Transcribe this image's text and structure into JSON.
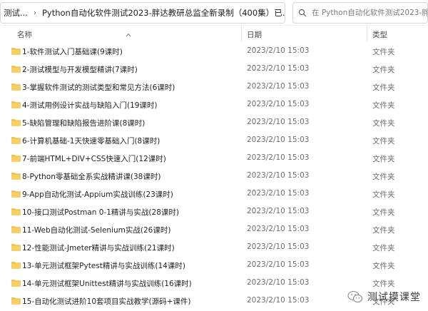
{
  "address_bar": {
    "crumbs": [
      "测试...",
      "Python自动化软件测试2023-胖达教研总监全新录制（400集）已..."
    ]
  },
  "search": {
    "placeholder": "在 Python自动化软件测试2023-胖达教研..."
  },
  "columns": {
    "name": "名称",
    "date": "日期",
    "type": "类型"
  },
  "rows": [
    {
      "name": "1-软件测试入门基础课(9课时)",
      "date": "2023/2/10 15:03",
      "type": "文件夹"
    },
    {
      "name": "2-测试模型与开发模型精讲(7课时)",
      "date": "2023/2/10 15:03",
      "type": "文件夹"
    },
    {
      "name": "3-掌握软件测试的测试类型和常见方法(6课时)",
      "date": "2023/2/10 15:03",
      "type": "文件夹"
    },
    {
      "name": "4-测试用例设计实战与缺陷入门(19课时)",
      "date": "2023/2/10 15:03",
      "type": "文件夹"
    },
    {
      "name": "5-缺陷管理和缺陷报告进阶课(8课时)",
      "date": "2023/2/10 15:03",
      "type": "文件夹"
    },
    {
      "name": "6-计算机基础-1天快速零基础入门(8课时)",
      "date": "2023/2/10 15:03",
      "type": "文件夹"
    },
    {
      "name": "7-前端HTML+DIV+CSS快速入门(12课时)",
      "date": "2023/2/10 15:03",
      "type": "文件夹"
    },
    {
      "name": "8-Python零基础全系实战精讲课(38课时)",
      "date": "2023/2/10 15:03",
      "type": "文件夹"
    },
    {
      "name": "9-App自动化测试-Appium实战训练(23课时)",
      "date": "2023/2/10 15:03",
      "type": "文件夹"
    },
    {
      "name": "10-接口测试Postman 0-1精讲与实战(28课时)",
      "date": "2023/2/10 15:03",
      "type": "文件夹"
    },
    {
      "name": "11-Web自动化测试-Selenium实战(26课时)",
      "date": "2023/2/10 15:03",
      "type": "文件夹"
    },
    {
      "name": "12-性能测试-Jmeter精讲与实战训练(21课时)",
      "date": "2023/2/10 15:03",
      "type": "文件夹"
    },
    {
      "name": "13-单元测试框架Pytest精讲与实战训练(14课时)",
      "date": "2023/2/10 15:03",
      "type": "文件夹"
    },
    {
      "name": "14-单元测试框架Unittest精讲与实战训练(16课时)",
      "date": "2023/2/10 15:03",
      "type": "文件夹"
    },
    {
      "name": "15-自动化测试进阶10套项目实战教学(源码+课件)",
      "date": "2023/2/10 15:03",
      "type": "文件夹"
    }
  ],
  "watermark": {
    "text": "测试摸课堂"
  },
  "colors": {
    "folder": "#f5c342",
    "folder_dark": "#e2a72a",
    "border": "#d6d6d6"
  },
  "icons": [
    "refresh-icon",
    "search-icon",
    "sort-up-icon",
    "folder-icon",
    "wechat-icon"
  ]
}
